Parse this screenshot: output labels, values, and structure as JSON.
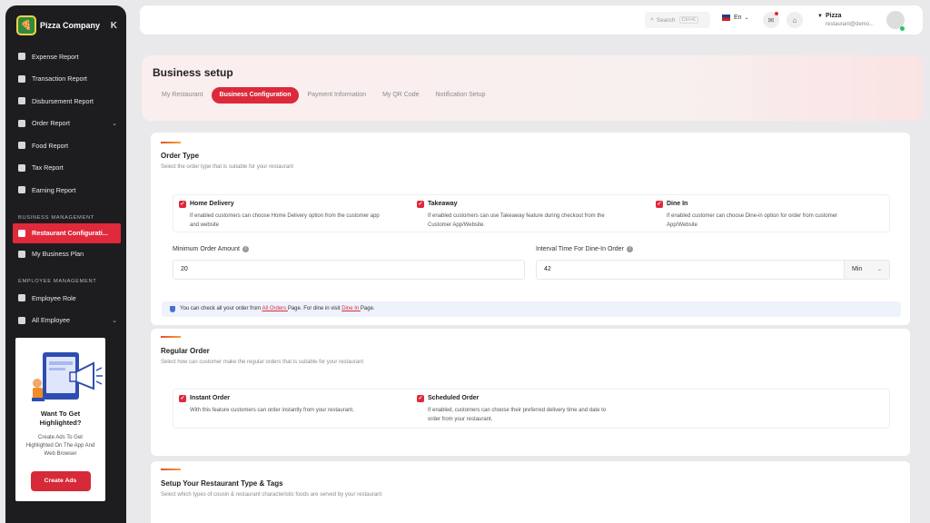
{
  "brand": {
    "name": "Pizza Company",
    "collapse_icon": "K"
  },
  "sidebar": {
    "items_top": [
      {
        "label": "Expense Report",
        "icon": "file-icon"
      },
      {
        "label": "Transaction Report",
        "icon": "file-icon"
      },
      {
        "label": "Disbursement Report",
        "icon": "file-icon"
      },
      {
        "label": "Order Report",
        "icon": "user-icon",
        "chevron": "⌄"
      },
      {
        "label": "Food Report",
        "icon": "file-icon"
      },
      {
        "label": "Tax Report",
        "icon": "file-icon"
      },
      {
        "label": "Earning Report",
        "icon": "file-icon"
      }
    ],
    "business_section": "BUSINESS MANAGEMENT",
    "business_items": [
      {
        "label": "Restaurant Configurati...",
        "icon": "home-icon"
      },
      {
        "label": "My Business Plan",
        "icon": "file-icon"
      }
    ],
    "employee_section": "EMPLOYEE MANAGEMENT",
    "employee_items": [
      {
        "label": "Employee Role",
        "icon": "file-icon"
      },
      {
        "label": "All Employee",
        "icon": "user-icon",
        "chevron": "⌄"
      }
    ],
    "promo": {
      "title_line1": "Want To Get",
      "title_line2": "Highlighted?",
      "text_line1": "Create Ads To Get",
      "text_line2": "Highlighted On The App And",
      "text_line3": "Web Browser",
      "button": "Create Ads"
    }
  },
  "header": {
    "search_placeholder": "Search",
    "search_shortcut": "Ctrl+K",
    "language": "En",
    "language_chevron": "⌄",
    "user_name": "Pizza",
    "user_email": "restaurant@demo..."
  },
  "page": {
    "title": "Business setup",
    "tabs": [
      "My Restaurant",
      "Business Configuration",
      "Payment Information",
      "My QR Code",
      "Notification Setup"
    ]
  },
  "order_type": {
    "title": "Order Type",
    "subtitle": "Select the order type that is suitable for your restaurant",
    "options": [
      {
        "title": "Home Delivery",
        "desc1": "If enabled customers can choose Home Delivery option from the customer app",
        "desc2": "and website"
      },
      {
        "title": "Takeaway",
        "desc1": "If enabled customers can use Takeaway feature during checkout from the",
        "desc2": "Customer App/Website."
      },
      {
        "title": "Dine In",
        "desc1": "If enabled customer can choose Dine-in option for order from customer",
        "desc2": "App/Website"
      }
    ],
    "min_order_label": "Minimum Order Amount",
    "min_order_value": "20",
    "interval_label": "Interval Time For Dine-In Order",
    "interval_value": "42",
    "interval_unit": "Min",
    "notice_prefix": "You can check all your order from ",
    "notice_link1": "All Orders ",
    "notice_mid": "Page. For dine in visit ",
    "notice_link2": "Dine In ",
    "notice_suffix": "Page."
  },
  "regular_order": {
    "title": "Regular Order",
    "subtitle": "Select how can customer make the regular orders that is suitable for your restaurant",
    "options": [
      {
        "title": "Instant Order",
        "desc1": "With this feature customers can order instantly from your restaurant.",
        "desc2": ""
      },
      {
        "title": "Scheduled Order",
        "desc1": "If enabled, customers can choose their preferred delivery time and date to",
        "desc2": "order from your restaurant."
      }
    ]
  },
  "restaurant_type": {
    "title": "Setup Your Restaurant Type & Tags",
    "subtitle": "Select which types of cousin & restaurant characteristic foods are served by your restaurant"
  }
}
